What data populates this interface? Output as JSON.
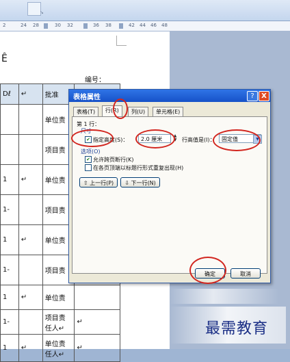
{
  "ruler": {
    "ticks": [
      "2",
      "24",
      "28",
      "30",
      "32",
      "36",
      "38",
      "42",
      "44",
      "46",
      "48"
    ]
  },
  "document": {
    "heading_fragment": "Ê",
    "number_label": "编号：",
    "table": {
      "header_row": [
        "Dℓ",
        "↵",
        "批准"
      ],
      "cells": {
        "unit_short": "单位责",
        "project_short": "项目责",
        "project_full": "项目责任人↵",
        "unit_full": "单位责任人↵",
        "paragraph_mark": "↵",
        "row_one": "1",
        "row_one_b": "1-"
      }
    }
  },
  "dialog": {
    "title": "表格属性",
    "help_icon": "?",
    "close_icon": "X",
    "tabs": [
      "表格(T)",
      "行(R)",
      "列(U)",
      "单元格(E)"
    ],
    "active_tab": "行(R)",
    "row_heading": "第 1 行：",
    "size_group": "尺寸",
    "specify_height_label": "指定高度(S)：",
    "specify_height_checked": true,
    "height_value": "2.0 厘米",
    "row_height_is_label": "行高值是(I)：",
    "row_height_mode": "固定值",
    "options_group": "选项(O)",
    "allow_break_label": "允许跨页断行(K)",
    "allow_break_checked": true,
    "repeat_header_label": "在各页顶端以标题行形式重复出现(H)",
    "repeat_header_checked": false,
    "prev_row_button": "上一行(P)",
    "next_row_button": "下一行(N)",
    "ok_button": "确定",
    "cancel_button": "取消",
    "title_bar_color": "#1651c8",
    "annotation_color": "#d2261f"
  },
  "watermark": {
    "text": "最需教育"
  }
}
